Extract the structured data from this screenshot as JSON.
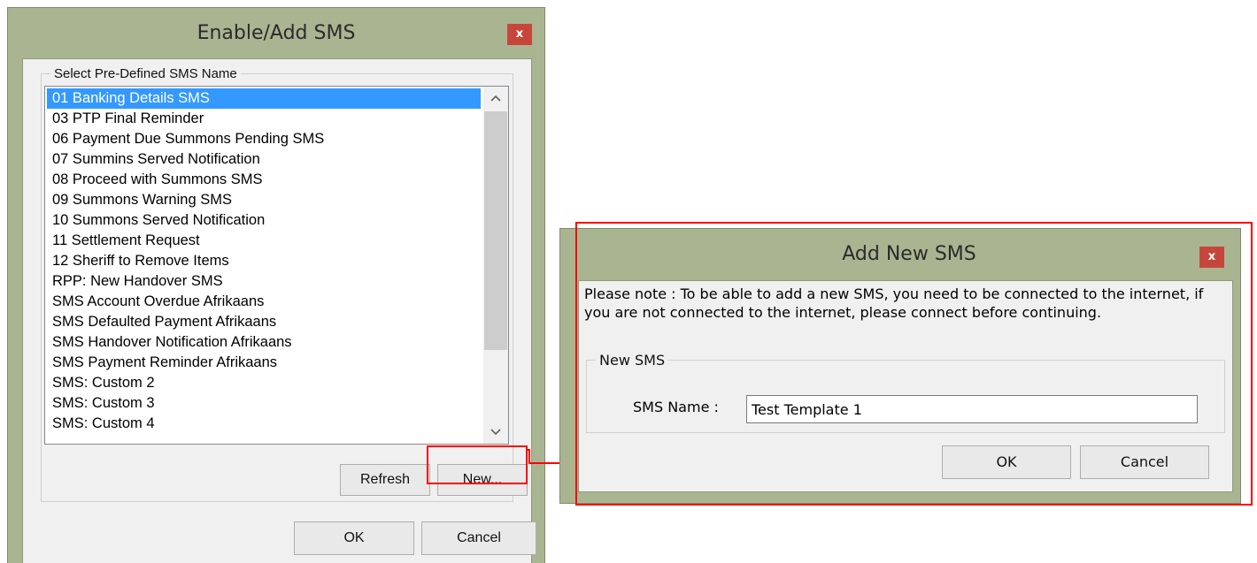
{
  "enable_window": {
    "title": "Enable/Add SMS",
    "close_label": "x",
    "group_label": "Select Pre-Defined SMS Name",
    "sms_list": [
      {
        "label": "01 Banking Details SMS",
        "selected": true
      },
      {
        "label": "03 PTP Final Reminder",
        "selected": false
      },
      {
        "label": "06 Payment Due Summons Pending SMS",
        "selected": false
      },
      {
        "label": "07 Summins Served Notification",
        "selected": false
      },
      {
        "label": "08 Proceed with Summons SMS",
        "selected": false
      },
      {
        "label": "09 Summons Warning SMS",
        "selected": false
      },
      {
        "label": "10 Summons Served Notification",
        "selected": false
      },
      {
        "label": "11 Settlement Request",
        "selected": false
      },
      {
        "label": "12 Sheriff to Remove Items",
        "selected": false
      },
      {
        "label": "RPP: New Handover SMS",
        "selected": false
      },
      {
        "label": "SMS Account Overdue Afrikaans",
        "selected": false
      },
      {
        "label": "SMS Defaulted Payment Afrikaans",
        "selected": false
      },
      {
        "label": "SMS Handover Notification Afrikaans",
        "selected": false
      },
      {
        "label": "SMS Payment Reminder Afrikaans",
        "selected": false
      },
      {
        "label": "SMS: Custom 2",
        "selected": false
      },
      {
        "label": "SMS: Custom 3",
        "selected": false
      },
      {
        "label": "SMS: Custom 4",
        "selected": false
      }
    ],
    "refresh_label": "Refresh",
    "new_label": "New...",
    "ok_label": "OK",
    "cancel_label": "Cancel"
  },
  "add_window": {
    "title": "Add New SMS",
    "close_label": "x",
    "note": "Please note : To be able to add a new SMS, you need to be connected to the internet, if you are not connected to the internet, please connect before continuing.",
    "group_label": "New SMS",
    "sms_name_label": "SMS Name :",
    "sms_name_value": "Test Template 1",
    "ok_label": "OK",
    "cancel_label": "Cancel"
  },
  "colors": {
    "frame": "#a9b591",
    "close_button": "#c7463c",
    "selection": "#3399ff",
    "annotation": "#ff0000"
  },
  "icons": {
    "scroll_up": "chevron-up-icon",
    "scroll_down": "chevron-down-icon",
    "connector": "arrow-right-icon"
  }
}
